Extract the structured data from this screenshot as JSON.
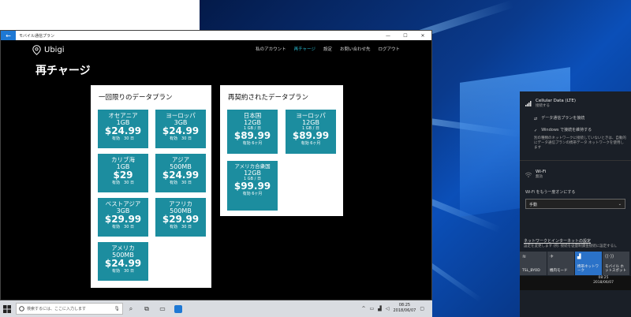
{
  "app": {
    "title": "モバイル通信プラン",
    "window_controls": {
      "minimize": "—",
      "maximize": "☐",
      "close": "✕"
    }
  },
  "nav": {
    "brand": "Ubigi",
    "links": [
      "私のアカウント",
      "再チャージ",
      "設定",
      "お問い合わせ先",
      "ログアウト"
    ],
    "active": "再チャージ"
  },
  "page": {
    "title": "再チャージ"
  },
  "one_time": {
    "title": "一回限りのデータプラン",
    "plans": [
      {
        "region": "オセアニア",
        "data": "1GB",
        "price": "$24.99",
        "validity": "有効　30 日"
      },
      {
        "region": "ヨーロッパ",
        "data": "3GB",
        "price": "$24.99",
        "validity": "有効　30 日"
      },
      {
        "region": "カリブ海",
        "data": "1GB",
        "price": "$29",
        "validity": "有効　30 日"
      },
      {
        "region": "アジア",
        "data": "500MB",
        "price": "$24.99",
        "validity": "有効　30 日"
      },
      {
        "region": "ベストアジア",
        "data": "3GB",
        "price": "$29.99",
        "validity": "有効　30 日"
      },
      {
        "region": "アフリカ",
        "data": "500MB",
        "price": "$29.99",
        "validity": "有効　30 日"
      },
      {
        "region": "アメリカ",
        "data": "500MB",
        "price": "$24.99",
        "validity": "有効　30 日"
      }
    ]
  },
  "recurring": {
    "title": "再契約されたデータプラン",
    "plans": [
      {
        "region": "日本国",
        "data": "12GB",
        "daily": "1 GB / 日",
        "price": "$89.99",
        "validity": "有効 6ヶ月"
      },
      {
        "region": "ヨーロッパ",
        "data": "12GB",
        "daily": "1 GB / 日",
        "price": "$89.99",
        "validity": "有効 6ヶ月"
      },
      {
        "region": "アメリカ合衆国",
        "data": "12GB",
        "daily": "1 GB / 日",
        "price": "$99.99",
        "validity": "有効 6ヶ月"
      }
    ]
  },
  "taskbar": {
    "search_placeholder": "検索するには、ここに入力します",
    "time": "08:25",
    "date": "2018/06/07"
  },
  "action_center": {
    "cellular_title": "Cellular Data (LTE)",
    "cellular_status": "接続する",
    "connect_plan": "データ通信プランを接続",
    "keep_connected": "Windows で接続を維持する",
    "note": "別の種類のネットワークに接続していないときは、自動的にデータ通信プランの携帯データ ネットワークを使用します",
    "wifi_title": "Wi-Fi",
    "wifi_status": "無効",
    "wifi_turn_on": "Wi-Fi をもう一度オンにする",
    "wifi_mode": "手動",
    "network_settings": "ネットワークとインターネットの設定",
    "network_settings_sub": "設定を変更します (例: 接続を従量制課金接続に設定する)。",
    "tiles": [
      "TSL_BYOD",
      "機内モード",
      "携帯ネットワーク",
      "モバイル ホットスポット"
    ],
    "time": "08:25",
    "date": "2018/06/07"
  },
  "colors": {
    "accent": "#1c8d9f",
    "nav_active": "#29c0d6",
    "titlebar_back": "#1e78d4"
  }
}
